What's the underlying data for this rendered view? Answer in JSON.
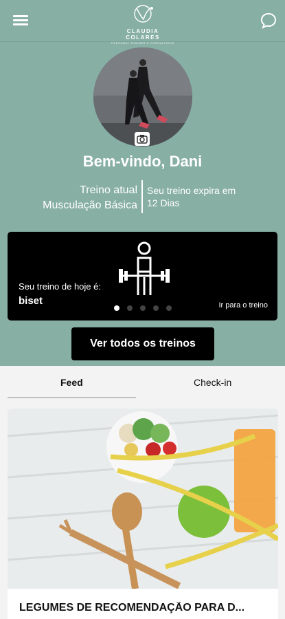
{
  "header": {
    "brand_name": "CLAUDIA COLARES",
    "brand_tagline": "PERSONAL TRAINER & CONSULTORIA",
    "menu_icon": "hamburger-menu-icon",
    "chat_icon": "chat-bubble-icon"
  },
  "profile": {
    "welcome": "Bem-vindo, Dani",
    "plan_label": "Treino atual",
    "plan_name": "Musculação Básica",
    "expire_label": "Seu treino expira em",
    "expire_value": "12 Dias"
  },
  "workout_card": {
    "today_label": "Seu treino de hoje é:",
    "today_value": "biset",
    "go_link": "Ir para o treino",
    "pages": 5,
    "active_page": 1
  },
  "actions": {
    "view_all": "Ver todos os treinos"
  },
  "tabs": [
    {
      "label": "Feed",
      "active": true
    },
    {
      "label": "Check-in",
      "active": false
    }
  ],
  "feed": [
    {
      "title": "LEGUMES DE RECOMENDAÇÃO PARA D..."
    }
  ],
  "colors": {
    "accent": "#87afa4",
    "card": "#000000"
  }
}
